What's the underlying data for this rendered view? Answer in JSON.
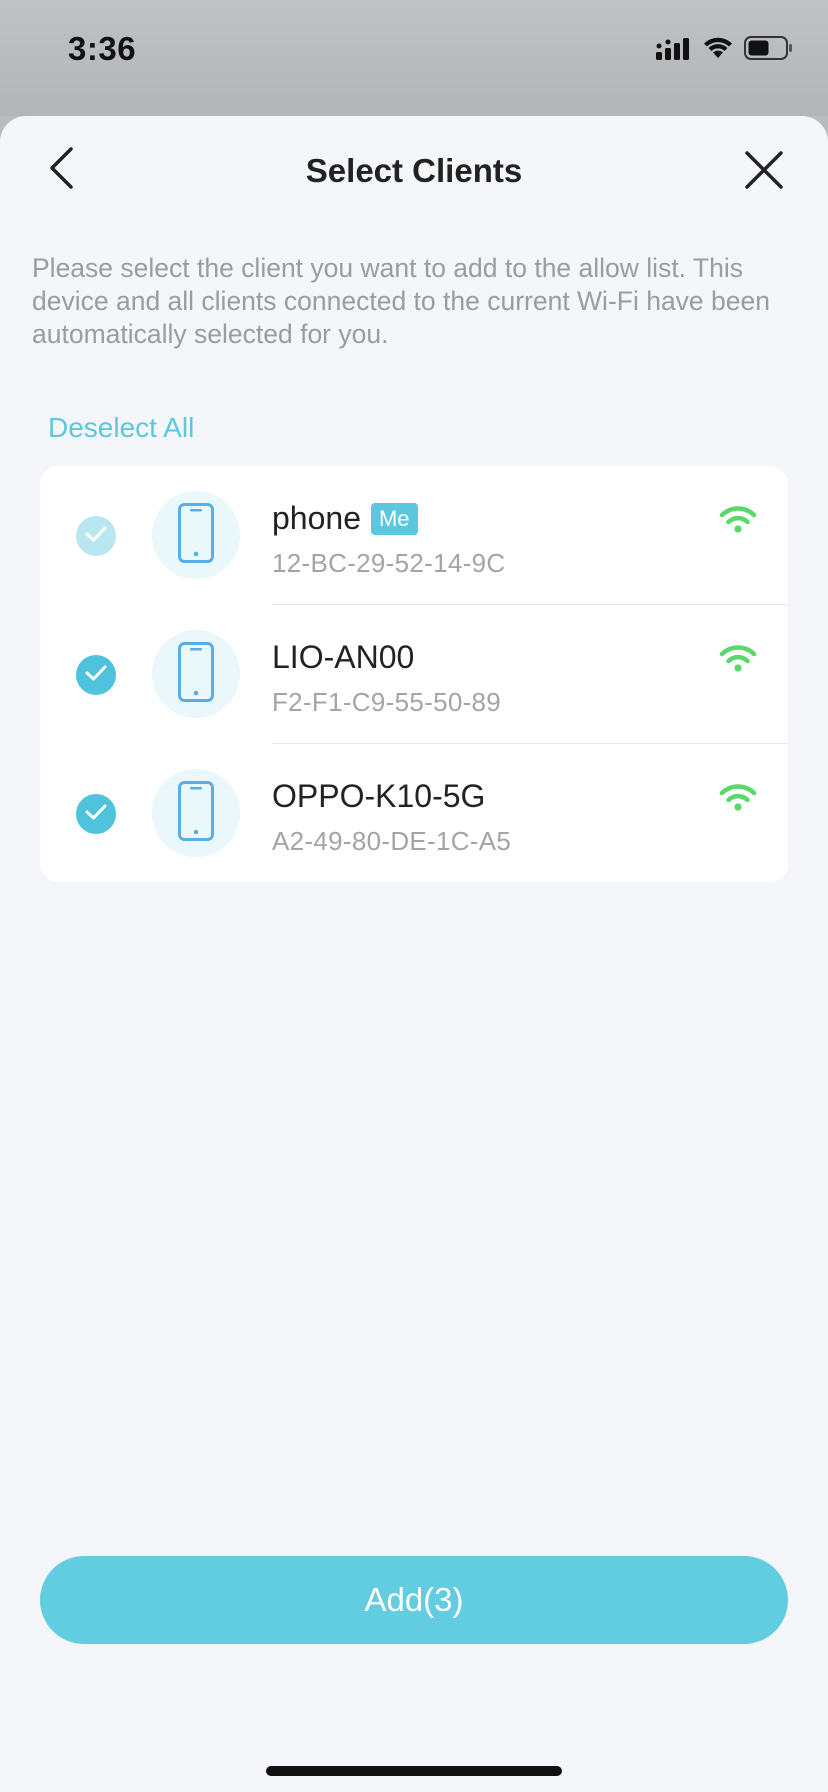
{
  "status_bar": {
    "time": "3:36",
    "icons": [
      "cellular-signal-icon",
      "wifi-icon",
      "battery-icon"
    ]
  },
  "nav": {
    "title": "Select Clients",
    "back_icon": "chevron-left-icon",
    "close_icon": "close-icon"
  },
  "description": "Please select the client you want to add to the allow list. This device and all clients connected to the current Wi-Fi have been automatically selected for you.",
  "deselect_all_label": "Deselect All",
  "clients": [
    {
      "name": "phone",
      "badge": "Me",
      "mac": "12-BC-29-52-14-9C",
      "selected": true,
      "locked": true,
      "icon": "smartphone-icon",
      "connection_icon": "wifi-signal-icon"
    },
    {
      "name": "LIO-AN00",
      "mac": "F2-F1-C9-55-50-89",
      "selected": true,
      "locked": false,
      "icon": "smartphone-icon",
      "connection_icon": "wifi-signal-icon"
    },
    {
      "name": "OPPO-K10-5G",
      "mac": "A2-49-80-DE-1C-A5",
      "selected": true,
      "locked": false,
      "icon": "smartphone-icon",
      "connection_icon": "wifi-signal-icon"
    }
  ],
  "add_button_label": "Add(3)",
  "colors": {
    "accent": "#5cc8df",
    "check": "#4fc3dc",
    "check_disabled": "#b9e7f1",
    "wifi_green": "#5ad86a",
    "sheet_bg": "#f4f6fa"
  }
}
